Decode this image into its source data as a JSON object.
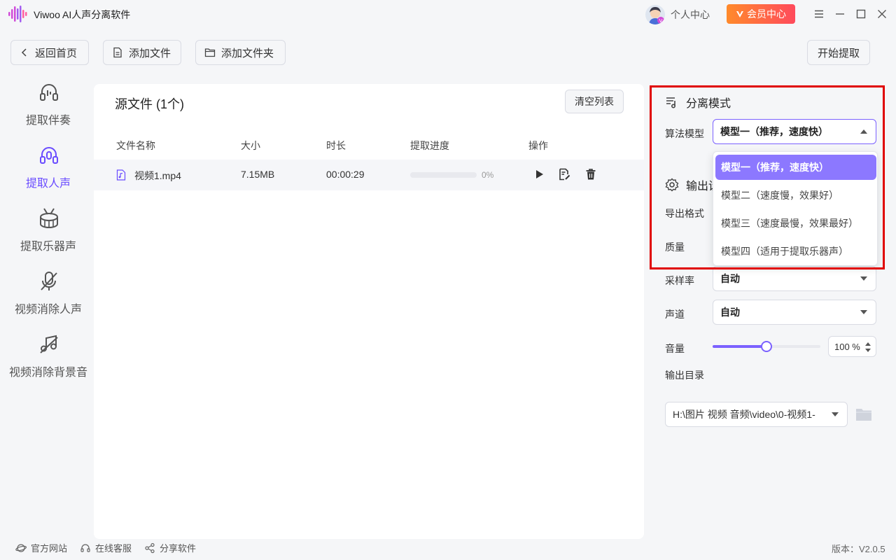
{
  "app": {
    "title": "Viwoo AI人声分离软件"
  },
  "header": {
    "user_center": "个人中心",
    "vip_label": "会员中心"
  },
  "toolbar": {
    "back": "返回首页",
    "add_file": "添加文件",
    "add_folder": "添加文件夹",
    "start": "开始提取"
  },
  "sidebar": {
    "items": [
      {
        "label": "提取伴奏",
        "icon": "headphones-icon"
      },
      {
        "label": "提取人声",
        "icon": "headset-mic-icon",
        "active": true
      },
      {
        "label": "提取乐器声",
        "icon": "drum-icon"
      },
      {
        "label": "视频消除人声",
        "icon": "mic-off-icon"
      },
      {
        "label": "视频消除背景音",
        "icon": "music-off-icon"
      }
    ]
  },
  "files": {
    "title": "源文件 (1个)",
    "clear": "清空列表",
    "columns": [
      "文件名称",
      "大小",
      "时长",
      "提取进度",
      "操作"
    ],
    "rows": [
      {
        "name": "视频1.mp4",
        "size": "7.15MB",
        "duration": "00:00:29",
        "progress": 0,
        "progress_label": "0%"
      }
    ]
  },
  "settings": {
    "mode_title": "分离模式",
    "algo_label": "算法模型",
    "algo_value": "模型一（推荐，速度快）",
    "algo_options": [
      "模型一（推荐，速度快）",
      "模型二（速度慢，效果好）",
      "模型三（速度最慢，效果最好）",
      "模型四（适用于提取乐器声）"
    ],
    "output_title": "输出设",
    "format_label": "导出格式",
    "quality_label": "质量",
    "sample_rate_label": "采样率",
    "sample_rate_value": "自动",
    "channel_label": "声道",
    "channel_value": "自动",
    "volume_label": "音量",
    "volume_value": "100 %",
    "volume_fraction": 0.5,
    "dir_label": "输出目录",
    "dir_value": "H:\\图片 视频 音频\\video\\0-视频1-"
  },
  "footer": {
    "website": "官方网站",
    "support": "在线客服",
    "share": "分享软件",
    "version": "版本：V2.0.5"
  },
  "colors": {
    "accent": "#7b61ff",
    "vip": "#ff5a4a",
    "highlight": "#e00000"
  }
}
